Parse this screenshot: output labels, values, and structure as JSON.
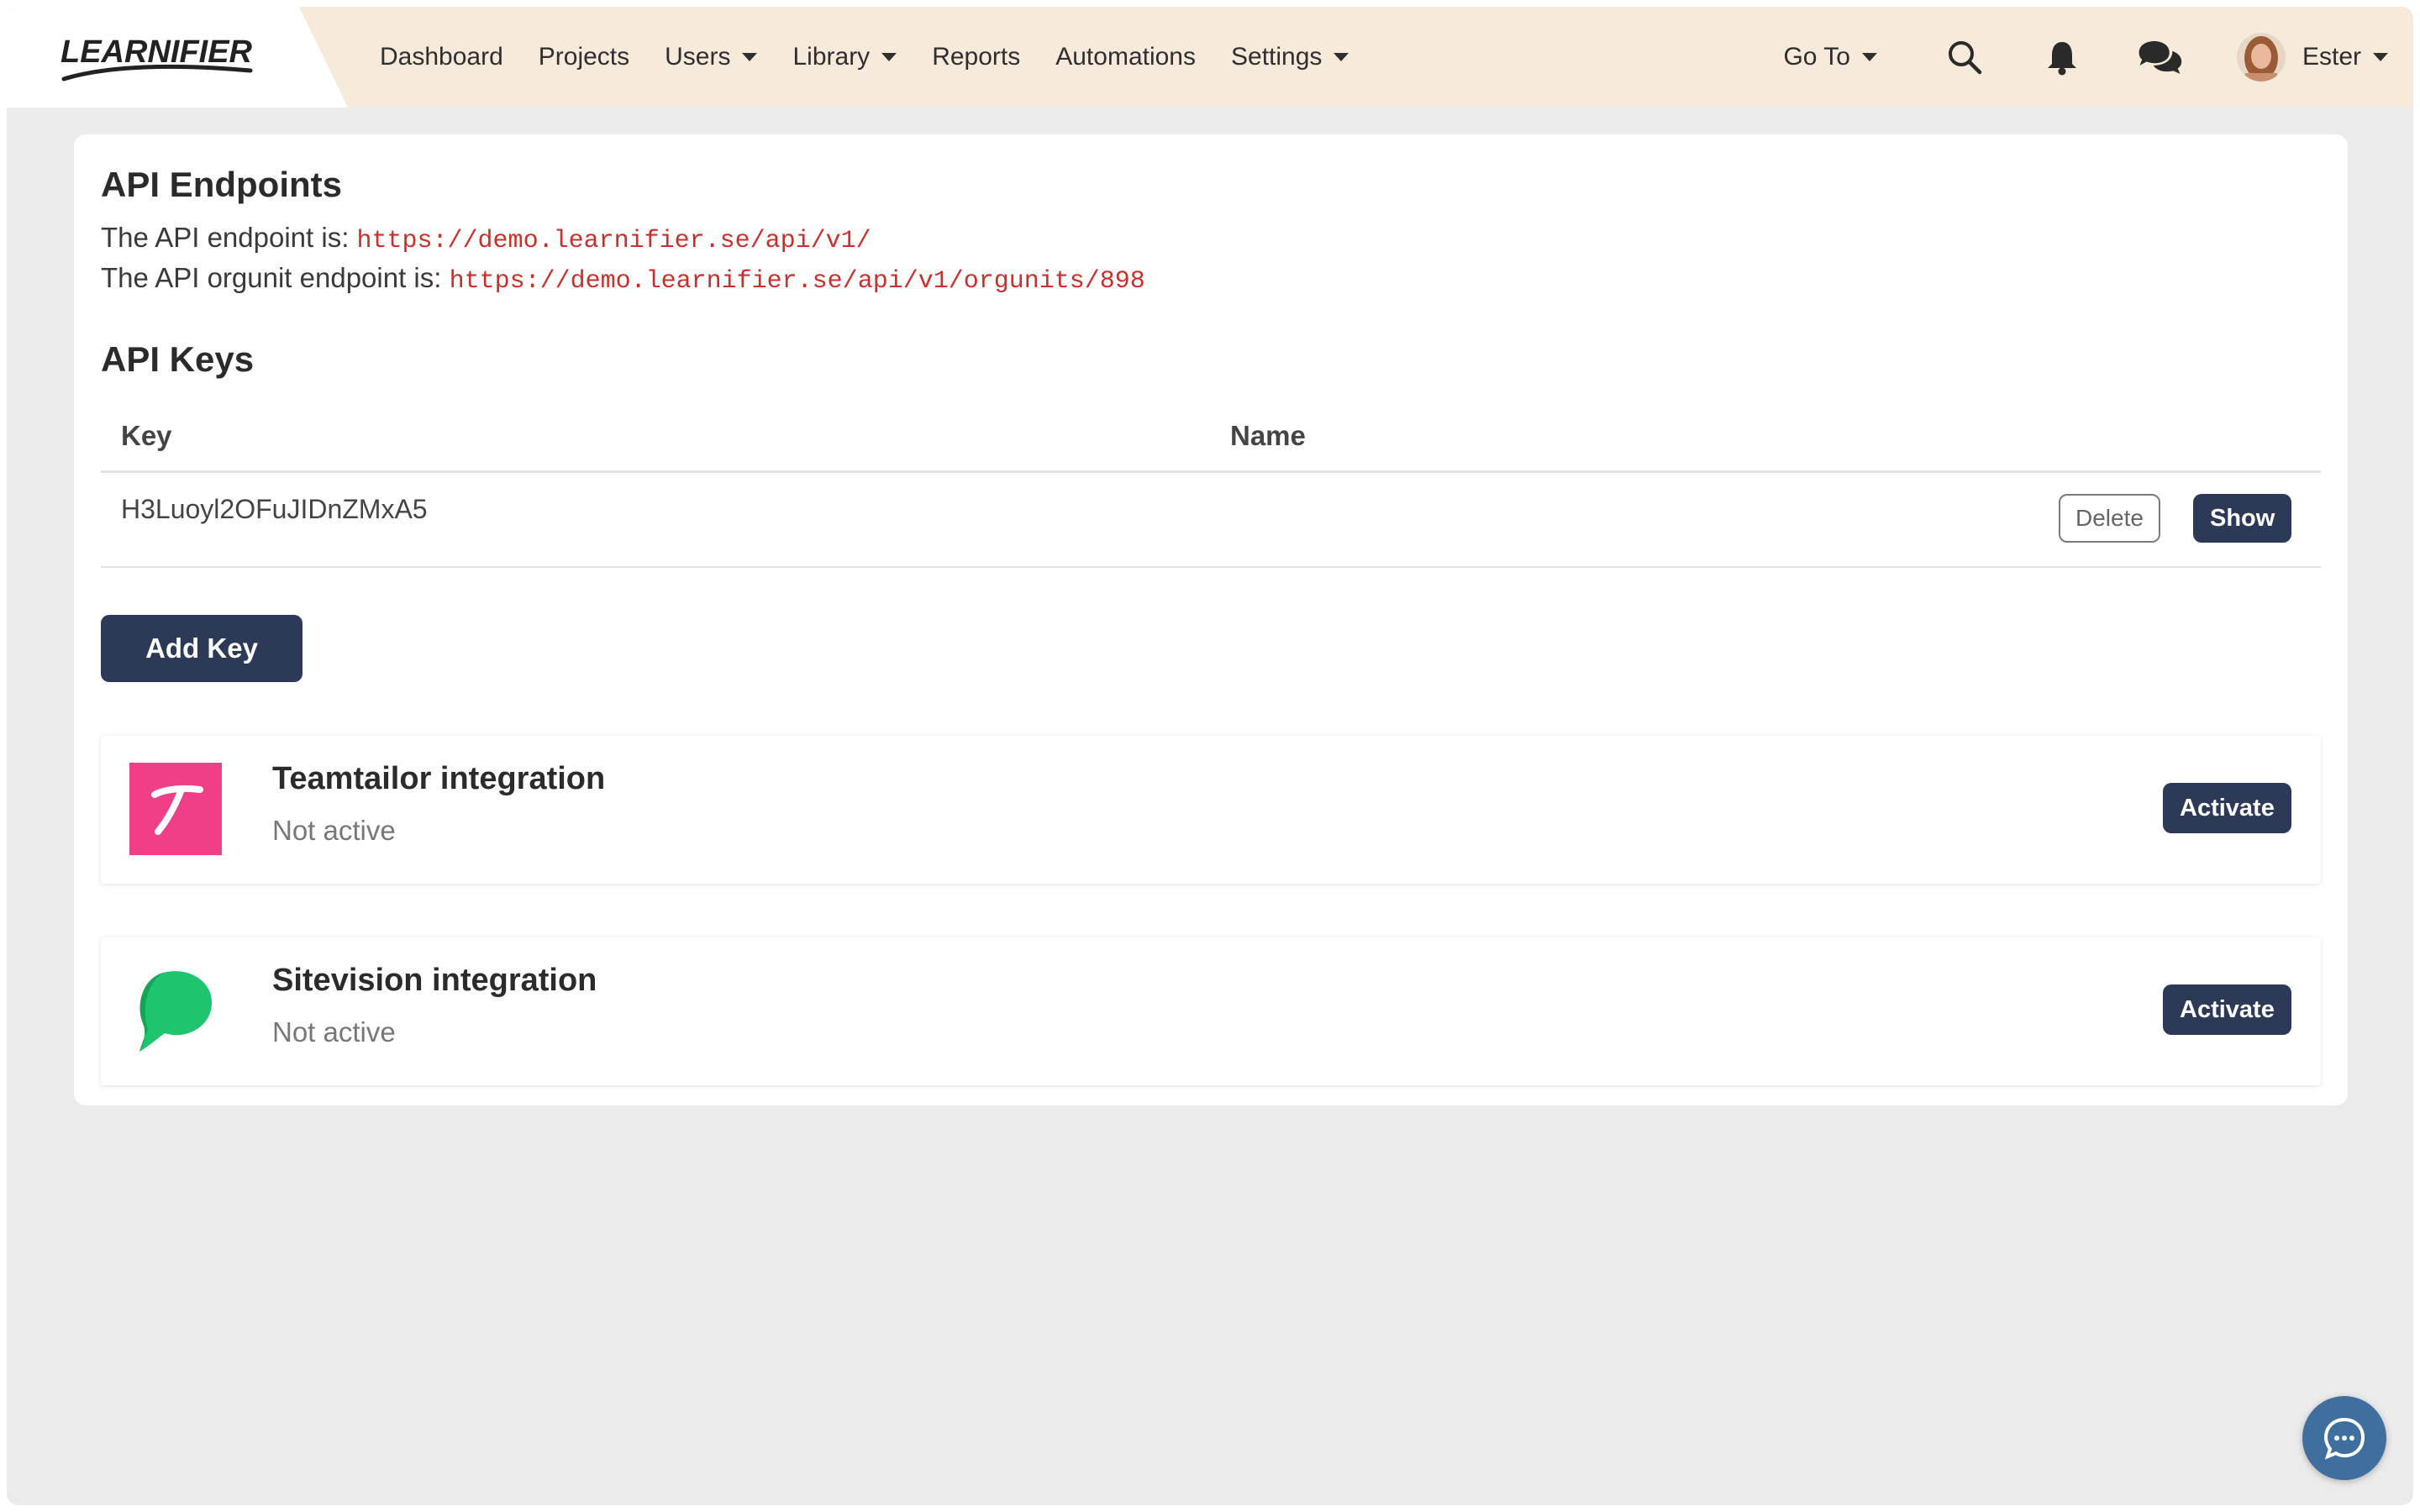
{
  "brand": {
    "logo_text": "LEARNIFIER"
  },
  "nav": {
    "items": [
      {
        "label": "Dashboard",
        "dropdown": false
      },
      {
        "label": "Projects",
        "dropdown": false
      },
      {
        "label": "Users",
        "dropdown": true
      },
      {
        "label": "Library",
        "dropdown": true
      },
      {
        "label": "Reports",
        "dropdown": false
      },
      {
        "label": "Automations",
        "dropdown": false
      },
      {
        "label": "Settings",
        "dropdown": true
      }
    ],
    "goto_label": "Go To",
    "icons": [
      "search-icon",
      "bell-icon",
      "chat-bubbles-icon"
    ],
    "user_name": "Ester"
  },
  "endpoints": {
    "title": "API Endpoints",
    "api_prefix": "The API endpoint is:",
    "api_url": "https://demo.learnifier.se/api/v1/",
    "orgunit_prefix": "The API orgunit endpoint is:",
    "orgunit_url": "https://demo.learnifier.se/api/v1/orgunits/898"
  },
  "keys": {
    "title": "API Keys",
    "columns": {
      "key": "Key",
      "name": "Name"
    },
    "rows": [
      {
        "key": "H3Luoyl2OFuJIDnZMxA5",
        "name": "",
        "delete_label": "Delete",
        "show_label": "Show"
      }
    ],
    "add_label": "Add Key"
  },
  "integrations": [
    {
      "title": "Teamtailor integration",
      "status": "Not active",
      "action": "Activate",
      "icon": "teamtailor-logo",
      "color": "#f03e87"
    },
    {
      "title": "Sitevision integration",
      "status": "Not active",
      "action": "Activate",
      "icon": "sitevision-logo",
      "color": "#1fc46e"
    }
  ],
  "colors": {
    "topbar": "#f7eadb",
    "primary_button": "#2c3a57",
    "code_text": "#c9302c",
    "chat_fab": "#3f6f9f"
  }
}
